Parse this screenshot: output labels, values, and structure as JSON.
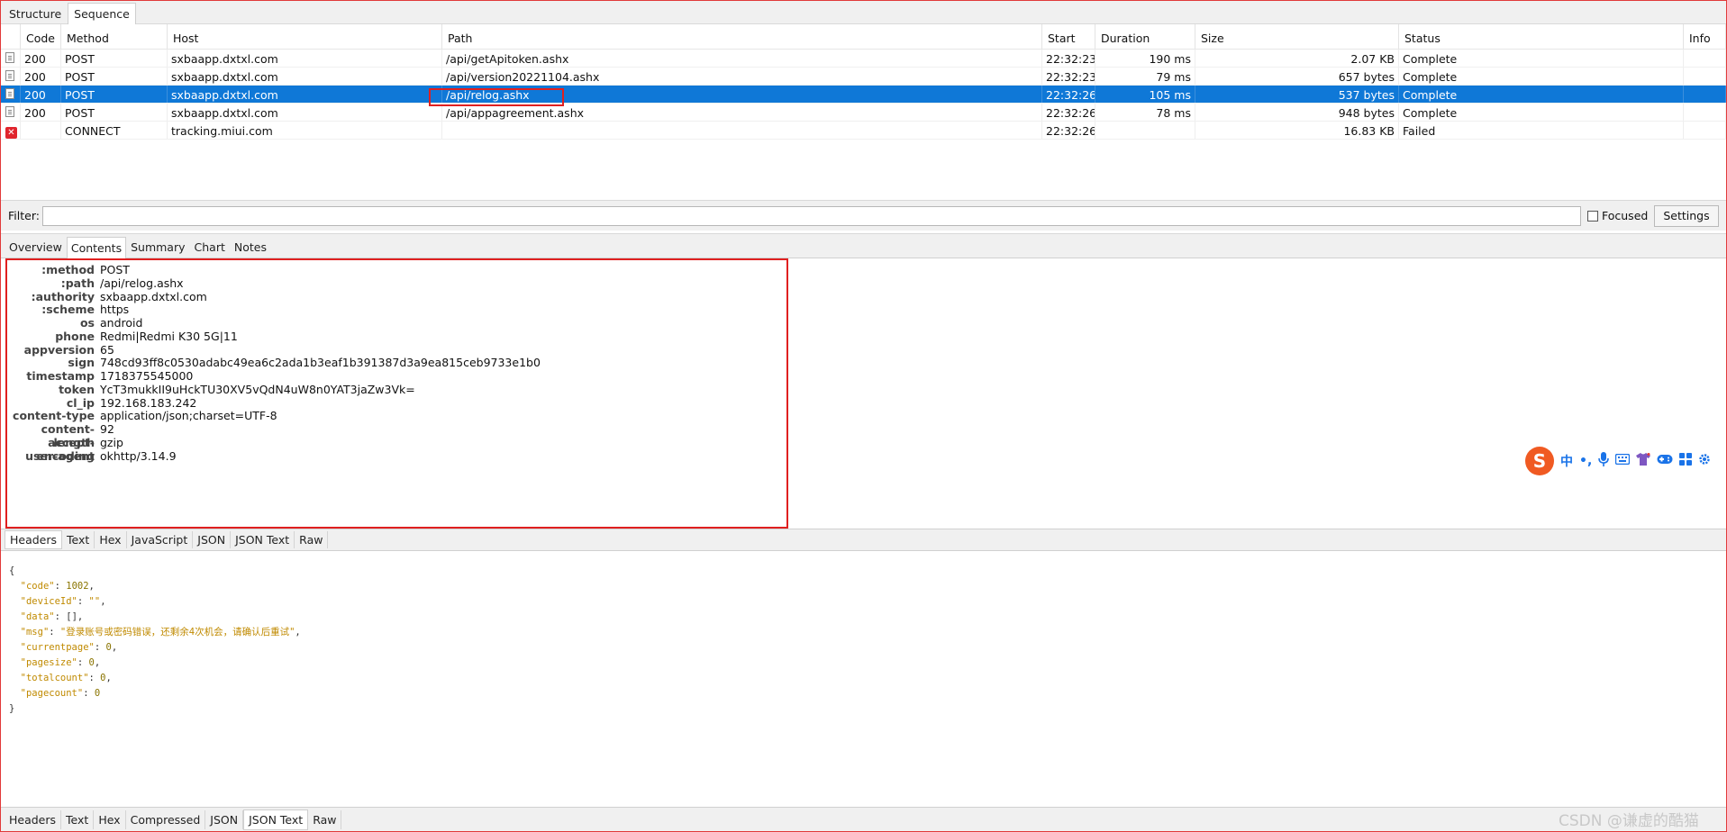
{
  "top_tabs": [
    "Structure",
    "Sequence"
  ],
  "table": {
    "columns": [
      "Code",
      "Method",
      "Host",
      "Path",
      "Start",
      "Duration",
      "Size",
      "Status",
      "Info"
    ],
    "rows": [
      {
        "icon": "document-icon",
        "code": "200",
        "method": "POST",
        "host": "sxbaapp.dxtxl.com",
        "path": "/api/getApitoken.ashx",
        "start": "22:32:23",
        "duration": "190 ms",
        "size": "2.07 KB",
        "status": "Complete",
        "info": ""
      },
      {
        "icon": "document-icon",
        "code": "200",
        "method": "POST",
        "host": "sxbaapp.dxtxl.com",
        "path": "/api/version20221104.ashx",
        "start": "22:32:23",
        "duration": "79 ms",
        "size": "657 bytes",
        "status": "Complete",
        "info": ""
      },
      {
        "icon": "document-icon",
        "code": "200",
        "method": "POST",
        "host": "sxbaapp.dxtxl.com",
        "path": "/api/relog.ashx",
        "start": "22:32:26",
        "duration": "105 ms",
        "size": "537 bytes",
        "status": "Complete",
        "info": "",
        "selected": true
      },
      {
        "icon": "document-icon",
        "code": "200",
        "method": "POST",
        "host": "sxbaapp.dxtxl.com",
        "path": "/api/appagreement.ashx",
        "start": "22:32:26",
        "duration": "78 ms",
        "size": "948 bytes",
        "status": "Complete",
        "info": ""
      },
      {
        "icon": "error-icon",
        "code": "",
        "method": "CONNECT",
        "host": "tracking.miui.com",
        "path": "",
        "start": "22:32:26",
        "duration": "",
        "size": "16.83 KB",
        "status": "Failed",
        "info": ""
      }
    ]
  },
  "filter": {
    "label": "Filter:",
    "value": "",
    "focused_label": "Focused",
    "settings_label": "Settings"
  },
  "detail_tabs": [
    "Overview",
    "Contents",
    "Summary",
    "Chart",
    "Notes"
  ],
  "request_headers": [
    {
      "key": ":method",
      "value": "POST"
    },
    {
      "key": ":path",
      "value": "/api/relog.ashx"
    },
    {
      "key": ":authority",
      "value": "sxbaapp.dxtxl.com"
    },
    {
      "key": ":scheme",
      "value": "https"
    },
    {
      "key": "os",
      "value": "android"
    },
    {
      "key": "phone",
      "value": "Redmi|Redmi K30 5G|11"
    },
    {
      "key": "appversion",
      "value": "65"
    },
    {
      "key": "sign",
      "value": "748cd93ff8c0530adabc49ea6c2ada1b3eaf1b391387d3a9ea815ceb9733e1b0"
    },
    {
      "key": "timestamp",
      "value": "1718375545000"
    },
    {
      "key": "token",
      "value": "YcT3mukkII9uHckTU30XV5vQdN4uW8n0YAT3jaZw3Vk="
    },
    {
      "key": "cl_ip",
      "value": "192.168.183.242"
    },
    {
      "key": "content-type",
      "value": "application/json;charset=UTF-8"
    },
    {
      "key": "content-length",
      "value": "92"
    },
    {
      "key": "accept-encoding",
      "value": "gzip"
    },
    {
      "key": "user-agent",
      "value": "okhttp/3.14.9"
    }
  ],
  "request_view_tabs": [
    "Headers",
    "Text",
    "Hex",
    "JavaScript",
    "JSON",
    "JSON Text",
    "Raw"
  ],
  "response_json": [
    {
      "t": "{"
    },
    {
      "k": "\"code\"",
      "v": "1002",
      "vt": "n",
      "comma": true
    },
    {
      "k": "\"deviceId\"",
      "v": "\"\"",
      "vt": "s",
      "comma": true
    },
    {
      "k": "\"data\"",
      "v": "[]",
      "vt": "p",
      "comma": true
    },
    {
      "k": "\"msg\"",
      "v": "\"登录账号或密码错误，还剩余4次机会，请确认后重试\"",
      "vt": "s",
      "comma": true
    },
    {
      "k": "\"currentpage\"",
      "v": "0",
      "vt": "n",
      "comma": true
    },
    {
      "k": "\"pagesize\"",
      "v": "0",
      "vt": "n",
      "comma": true
    },
    {
      "k": "\"totalcount\"",
      "v": "0",
      "vt": "n",
      "comma": true
    },
    {
      "k": "\"pagecount\"",
      "v": "0",
      "vt": "n",
      "comma": false
    },
    {
      "t": "}"
    }
  ],
  "response_view_tabs": [
    "Headers",
    "Text",
    "Hex",
    "Compressed",
    "JSON",
    "JSON Text",
    "Raw"
  ],
  "ime_toolbar": {
    "logo": "S",
    "items": [
      "中",
      "•,",
      "mic-icon",
      "keyboard-icon",
      "shirt-icon",
      "gamepad-icon",
      "grid-icon",
      "gear-icon"
    ],
    "chinese_label": "中",
    "punct_label": "•,"
  },
  "watermark": "CSDN @谦虚的酷猫",
  "colors": {
    "selection": "#0f78d7",
    "highlight": "#e02020",
    "json_value": "#c08a00"
  }
}
